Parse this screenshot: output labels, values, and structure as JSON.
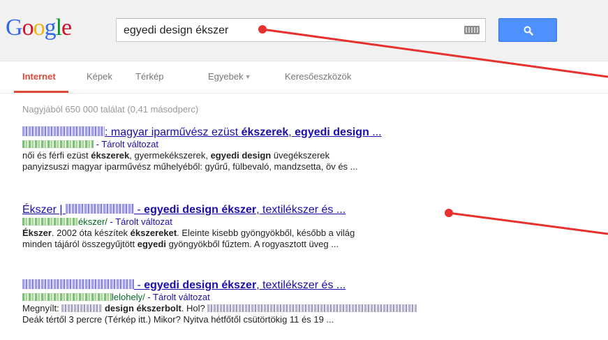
{
  "header": {
    "logo_letters": [
      {
        "ch": "G",
        "color": "#3369e8"
      },
      {
        "ch": "o",
        "color": "#d50f25"
      },
      {
        "ch": "o",
        "color": "#eeb211"
      },
      {
        "ch": "g",
        "color": "#3369e8"
      },
      {
        "ch": "l",
        "color": "#009925"
      },
      {
        "ch": "e",
        "color": "#d50f25"
      }
    ],
    "search_value": "egyedi design ékszer"
  },
  "tabs": [
    "Internet",
    "Képek",
    "Térkép",
    "Egyebek",
    "Keresőeszközök"
  ],
  "stats": "Nagyjából 650 000 találat (0,41 másodperc)",
  "results": [
    {
      "title_rest": ": magyar iparművész ezüst ",
      "title_b1": "ékszerek",
      "title_sep": ", ",
      "title_b2": "egyedi design",
      "title_end": " ...",
      "cache": "- Tárolt változat",
      "s1": "női és férfi ezüst ",
      "s1b": "ékszerek",
      "s2": ", gyermekékszerek, ",
      "s2b": "egyedi design",
      "s3": " üvegékszerek",
      "s4": "panyizsuszi magyar iparművész műhelyéből: gyűrű, fülbevaló, mandzsetta, öv és ..."
    },
    {
      "title_a": "Ékszer | ",
      "title_sep": " - ",
      "title_b": "egyedi design ékszer",
      "title_end": ", textilékszer és ...",
      "url_tail": "ékszer/",
      "cache": "- Tárolt változat",
      "s1b": "Ékszer",
      "s1": ". 2002 óta készítek ",
      "s1b2": "ékszereket",
      "s1e": ". Eleinte kisebb gyöngyökből, később a világ",
      "s2": "minden tájáról összegyűjtött ",
      "s2b": "egyedi",
      "s2e": " gyöngyökből fűztem. A rogyasztott üveg ..."
    },
    {
      "title_sep": " - ",
      "title_b": "egyedi design ékszer",
      "title_end": ", textilékszer és ...",
      "url_tail": "lelohely/",
      "cache": "- Tárolt változat",
      "s1": "Megnyílt: ",
      "s1b": "design ékszerbolt",
      "s1e": ". Hol?",
      "s2": "Deák tértől 3 percre (Térkép itt.) Mikor? Nyitva hétfőtől csütörtökig 11 és 19 ..."
    }
  ],
  "annotation_color": "#e8302e"
}
